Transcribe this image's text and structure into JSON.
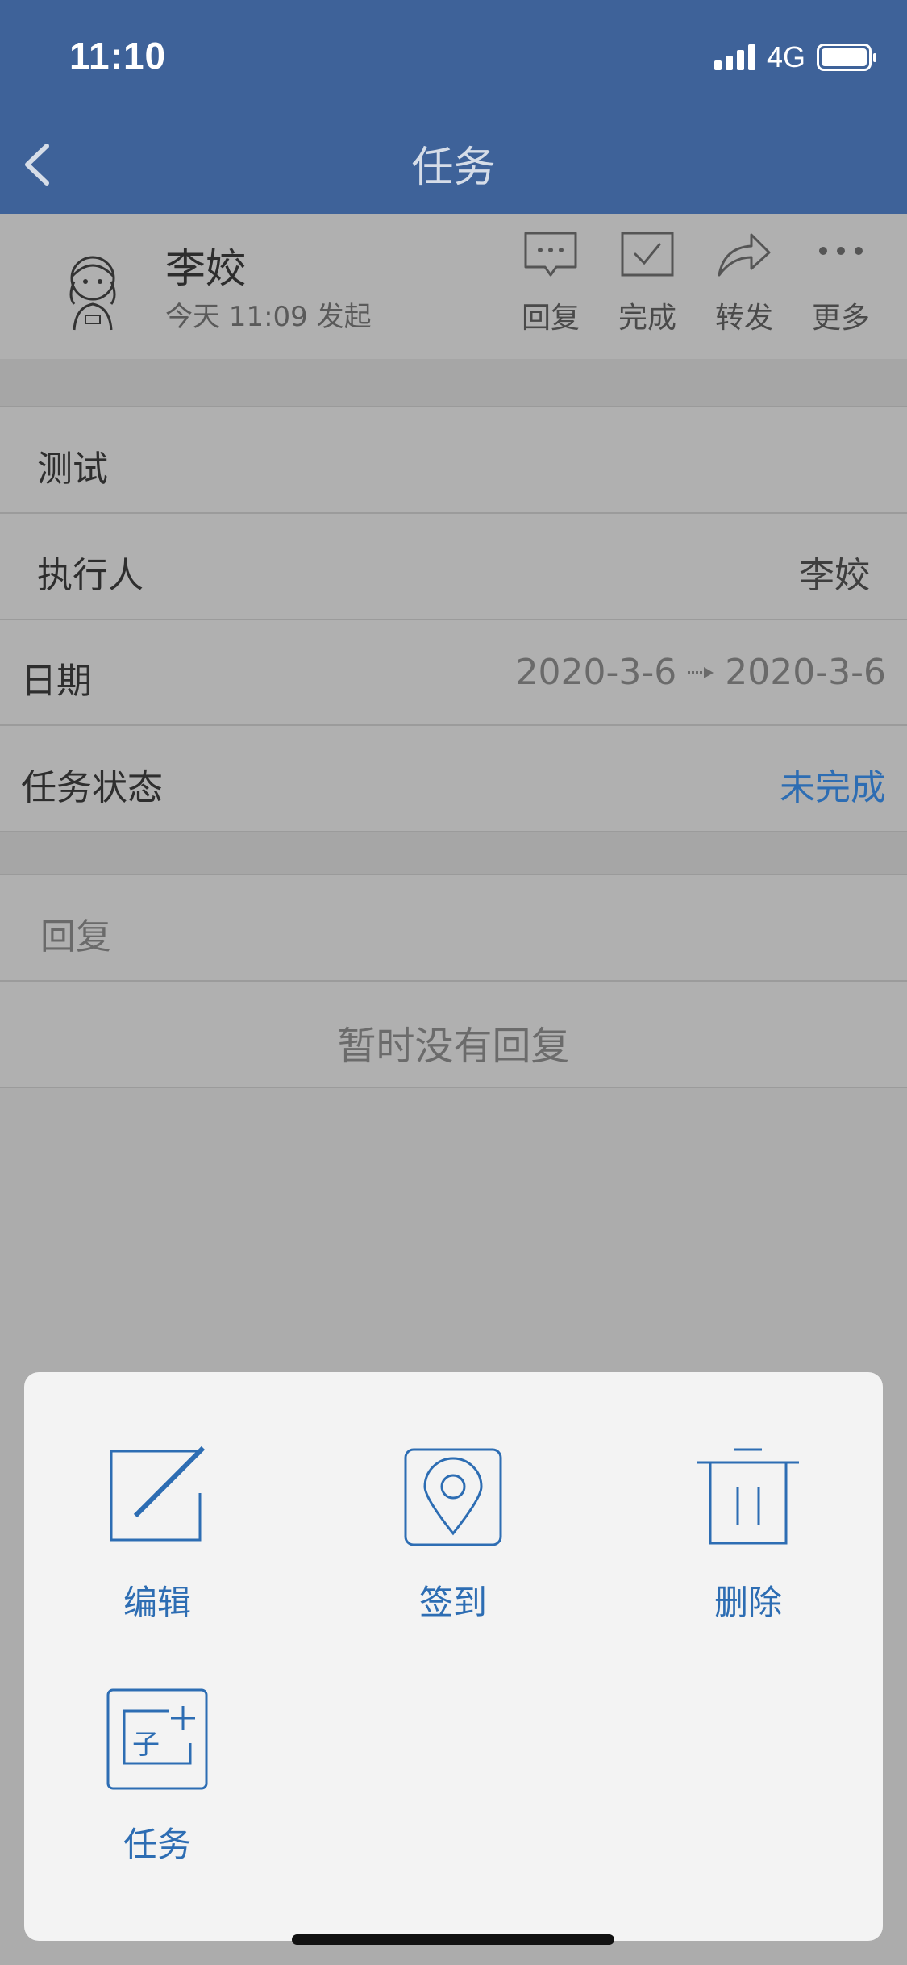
{
  "status": {
    "time": "11:10",
    "network": "4G"
  },
  "nav": {
    "title": "任务"
  },
  "header": {
    "author": "李姣",
    "subtitle": "今天 11:09 发起",
    "actions": [
      {
        "label": "回复",
        "icon": "chat-bubble-icon"
      },
      {
        "label": "完成",
        "icon": "checkbox-icon"
      },
      {
        "label": "转发",
        "icon": "forward-icon"
      },
      {
        "label": "更多",
        "icon": "more-icon"
      }
    ]
  },
  "task": {
    "title": "测试",
    "assignee_label": "执行人",
    "assignee": "李姣",
    "date_label": "日期",
    "date_start": "2020-3-6",
    "date_end": "2020-3-6",
    "status_label": "任务状态",
    "status": "未完成"
  },
  "replies": {
    "label": "回复",
    "empty": "暂时没有回复"
  },
  "sheet": {
    "items": [
      {
        "label": "编辑",
        "icon": "edit-icon"
      },
      {
        "label": "签到",
        "icon": "location-pin-icon"
      },
      {
        "label": "删除",
        "icon": "trash-icon"
      },
      {
        "label": "任务",
        "icon": "subtask-add-icon",
        "icon_text": "子"
      }
    ]
  },
  "colors": {
    "nav": "#3e6299",
    "accent": "#2d6db3",
    "overlay": "#acacac",
    "sheet": "#f3f3f3"
  }
}
